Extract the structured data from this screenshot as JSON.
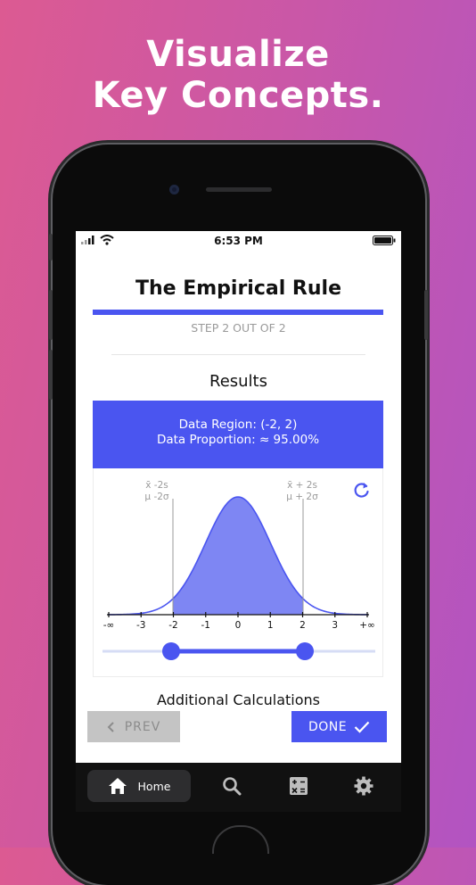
{
  "headline": {
    "line1": "Visualize",
    "line2": "Key Concepts."
  },
  "status": {
    "time": "6:53 PM"
  },
  "app": {
    "title": "The Empirical Rule",
    "step_text": "STEP 2 OUT OF 2",
    "results_heading": "Results",
    "data_region": "Data Region: (-2, 2)",
    "data_proportion": "Data Proportion: ≈ 95.00%",
    "left_marker_line1": "x̄ -2s",
    "left_marker_line2": "μ -2σ",
    "right_marker_line1": "x̄ + 2s",
    "right_marker_line2": "μ + 2σ",
    "axis_ticks": [
      "-∞",
      "-3",
      "-2",
      "-1",
      "0",
      "1",
      "2",
      "3",
      "+∞"
    ],
    "slider_low": -2,
    "slider_high": 2,
    "additional_heading": "Additional Calculations",
    "prev_label": "PREV",
    "done_label": "DONE"
  },
  "tabbar": {
    "home_label": "Home"
  },
  "colors": {
    "accent": "#4a55f0",
    "curve_fill": "#7e86f3",
    "prev_bg": "#c4c4c4"
  },
  "icons": [
    "refresh-icon",
    "home-icon",
    "search-icon",
    "calculator-icon",
    "gear-icon",
    "checkmark-icon",
    "chevron-left-icon",
    "wifi-icon",
    "signal-icon",
    "battery-icon"
  ]
}
